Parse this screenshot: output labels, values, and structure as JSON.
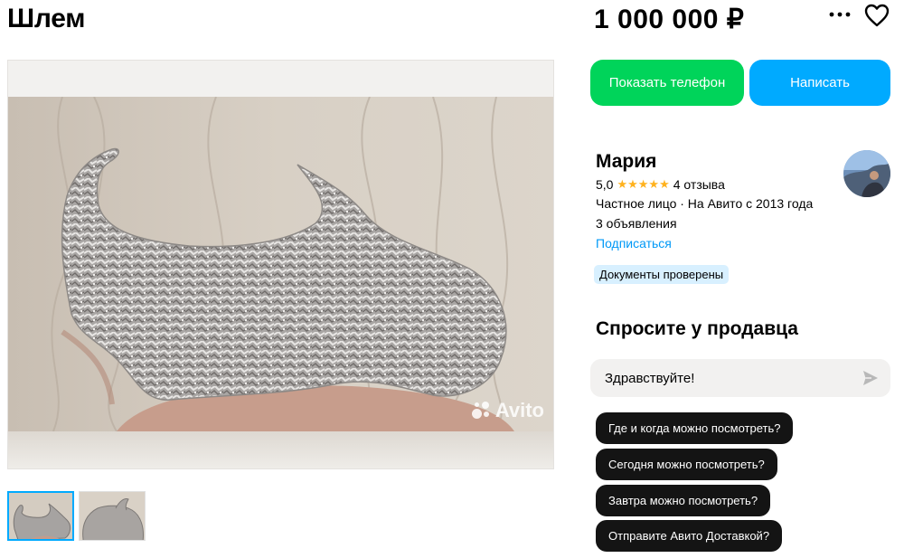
{
  "listing": {
    "title": "Шлем",
    "price": "1 000 000 ₽"
  },
  "header_actions": {
    "more_icon": "more-horizontal-icon",
    "favorite_icon": "heart-outline-icon"
  },
  "gallery": {
    "watermark": "Avito",
    "thumbnail_count": 2,
    "selected_thumbnail": 1
  },
  "actions": {
    "show_phone_label": "Показать телефон",
    "write_label": "Написать"
  },
  "seller": {
    "name": "Мария",
    "rating": "5,0",
    "stars": "★★★★★",
    "reviews": "4 отзыва",
    "info": "Частное лицо · На Авито с 2013 года",
    "ads": "3 объявления",
    "subscribe": "Подписаться",
    "badge": "Документы проверены"
  },
  "ask": {
    "title": "Спросите у продавца",
    "message_value": "Здравствуйте!",
    "send_icon": "send-arrow-icon",
    "quick_questions": [
      "Где и когда можно посмотреть?",
      "Сегодня можно посмотреть?",
      "Завтра можно посмотреть?",
      "Отправите Авито Доставкой?"
    ]
  },
  "colors": {
    "phone_button": "#00d45a",
    "write_button": "#00aaff",
    "link": "#0099f7",
    "stars": "#ffb21e",
    "chip_bg": "#141414",
    "badge_bg": "#d8f0ff"
  }
}
